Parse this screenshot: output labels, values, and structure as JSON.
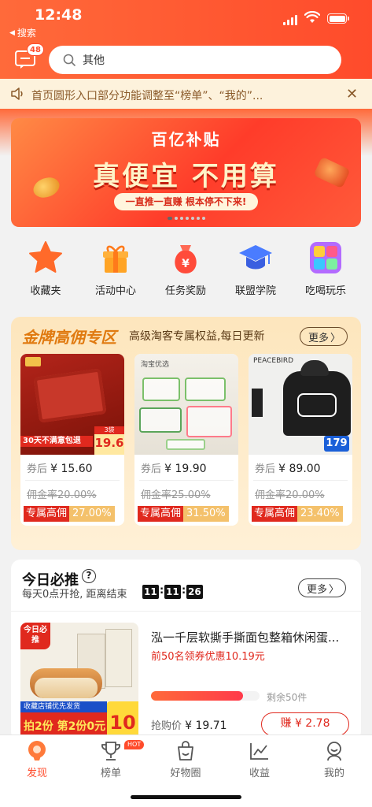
{
  "status": {
    "time": "12:48",
    "back_label": "搜索"
  },
  "header": {
    "msg_count": "48",
    "search_placeholder": "其他"
  },
  "notice": {
    "text": "首页圆形入口部分功能调整至“榜单”、“我的”..."
  },
  "banner": {
    "brand": "百亿补贴",
    "headline": "真便宜 不用算",
    "pill": "一直推一直赚 根本停不下来!",
    "page_count": 7,
    "active_page": 0
  },
  "quick_nav": [
    {
      "label": "收藏夹",
      "icon": "star-icon",
      "color": "#ff6a2a"
    },
    {
      "label": "活动中心",
      "icon": "gift-icon",
      "color": "#ffa425"
    },
    {
      "label": "任务奖励",
      "icon": "money-bag-icon",
      "color": "#ff4b3a"
    },
    {
      "label": "联盟学院",
      "icon": "graduation-cap-icon",
      "color": "#4a7cff"
    },
    {
      "label": "吃喝玩乐",
      "icon": "apps-grid-icon",
      "color": "#b36bff"
    }
  ],
  "gold_zone": {
    "title": "金牌高佣专区",
    "subtitle": "高级淘客专属权益,每日更新",
    "more": "更多",
    "cards": [
      {
        "price_prefix": "券后",
        "price": "¥ 15.60",
        "rate_prefix": "佣金率",
        "old_rate": "20.00%",
        "tag_label": "专属高佣",
        "tag_rate": "27.00%",
        "img": {
          "banner": "30天不满意包退",
          "badge": "19.6",
          "badge_note": "3袋"
        }
      },
      {
        "price_prefix": "券后",
        "price": "¥ 19.90",
        "rate_prefix": "佣金率",
        "old_rate": "25.00%",
        "tag_label": "专属高佣",
        "tag_rate": "31.50%",
        "img": {
          "brand": "淘宝优选"
        }
      },
      {
        "price_prefix": "券后",
        "price": "¥ 89.00",
        "rate_prefix": "佣金率",
        "old_rate": "20.00%",
        "tag_label": "专属高佣",
        "tag_rate": "23.40%",
        "img": {
          "brand": "PEACEBIRD",
          "badge": "179"
        }
      }
    ]
  },
  "today": {
    "title": "今日必推",
    "subtitle": "每天0点开抢, 距离结束",
    "countdown": [
      "11",
      "11",
      "26"
    ],
    "more": "更多",
    "product": {
      "name": "泓一千层软撕手撕面包整箱休闲蛋...",
      "coupon": "前50名领券优惠10.19元",
      "progress": 0.85,
      "remain": "剩余50件",
      "price_label": "抢购价",
      "price": "¥ 19.71",
      "earn": "赚 ¥ 2.78",
      "img": {
        "corner": "今日必推",
        "promo": "拍2份 第2份0元",
        "promo_price": "10",
        "promo_note": "收藏店铺优先发货"
      }
    }
  },
  "tabs": [
    {
      "label": "发现",
      "icon": "discover-icon",
      "active": true
    },
    {
      "label": "榜单",
      "icon": "trophy-icon",
      "badge": "HOT"
    },
    {
      "label": "好物圈",
      "icon": "bag-icon"
    },
    {
      "label": "收益",
      "icon": "chart-icon"
    },
    {
      "label": "我的",
      "icon": "profile-icon"
    }
  ],
  "colors": {
    "primary": "#ff4b2b",
    "gold": "#e07a10",
    "red_tag": "#e0291e"
  }
}
